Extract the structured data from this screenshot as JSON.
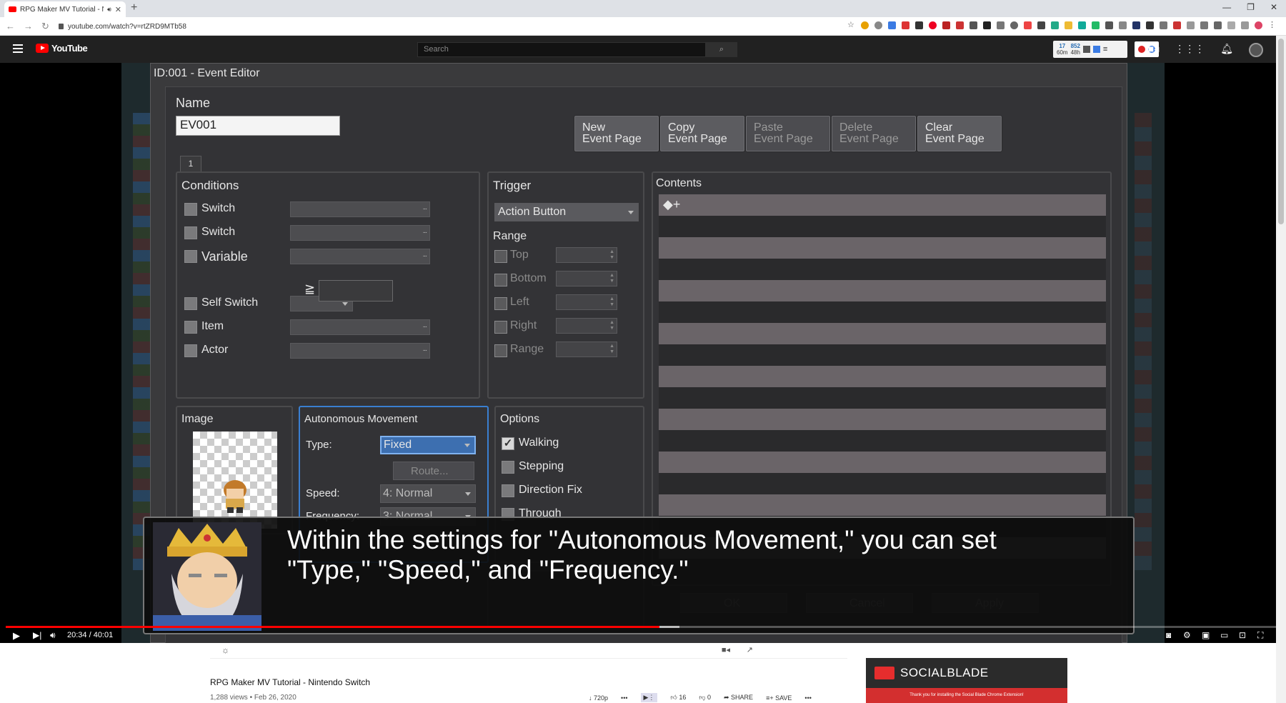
{
  "browser": {
    "tab_title": "RPG Maker MV Tutorial - Nir",
    "url": "youtube.com/watch?v=rtZRD9MTb58"
  },
  "youtube": {
    "logo_text": "YouTube",
    "search_placeholder": "Search",
    "socialblade_widget": {
      "a": "17",
      "a_sub": "60m",
      "b": "852",
      "b_sub": "48h"
    }
  },
  "editor": {
    "title": "ID:001 - Event Editor",
    "name_label": "Name",
    "name_value": "EV001",
    "page_buttons": [
      {
        "line1": "New",
        "line2": "Event Page",
        "enabled": true
      },
      {
        "line1": "Copy",
        "line2": "Event Page",
        "enabled": true
      },
      {
        "line1": "Paste",
        "line2": "Event Page",
        "enabled": false
      },
      {
        "line1": "Delete",
        "line2": "Event Page",
        "enabled": false
      },
      {
        "line1": "Clear",
        "line2": "Event Page",
        "enabled": true
      }
    ],
    "page_tab": "1",
    "conditions": {
      "title": "Conditions",
      "items": [
        "Switch",
        "Switch",
        "Variable",
        "Self Switch",
        "Item",
        "Actor"
      ],
      "ge_symbol": "≧"
    },
    "trigger": {
      "title": "Trigger",
      "value": "Action Button",
      "range_title": "Range",
      "range_items": [
        "Top",
        "Bottom",
        "Left",
        "Right",
        "Range"
      ]
    },
    "contents": {
      "title": "Contents",
      "first_row": "◆+"
    },
    "image": {
      "title": "Image"
    },
    "autonomous": {
      "title": "Autonomous Movement",
      "type_label": "Type:",
      "type_value": "Fixed",
      "route_button": "Route...",
      "speed_label": "Speed:",
      "speed_value": "4: Normal",
      "frequency_label": "Frequency:",
      "frequency_value": "3: Normal"
    },
    "options": {
      "title": "Options",
      "items": [
        {
          "label": "Walking",
          "checked": true
        },
        {
          "label": "Stepping",
          "checked": false
        },
        {
          "label": "Direction Fix",
          "checked": false
        },
        {
          "label": "Through",
          "checked": false
        }
      ]
    },
    "bottom_buttons": [
      "OK",
      "Cancel",
      "Apply"
    ]
  },
  "subtitle": {
    "line1": "Within the settings for \"Autonomous Movement,\" you can set",
    "line2": "\"Type,\" \"Speed,\" and \"Frequency.\""
  },
  "player": {
    "time": "20:34 / 40:01",
    "progress": 0.514
  },
  "video": {
    "title": "RPG Maker MV Tutorial - Nintendo Switch",
    "meta": "1,288 views • Feb 26, 2020",
    "quality": "720p",
    "likes": "16",
    "dislikes": "0",
    "share": "SHARE",
    "save": "SAVE"
  },
  "socialblade": {
    "name": "SOCIALBLADE",
    "footer": "Thank you for installing the Social Blade Chrome Extension!"
  },
  "colors": {
    "accent_red": "#ff0000",
    "selection_blue": "#3a7fd0",
    "editor_bg": "#333336"
  }
}
